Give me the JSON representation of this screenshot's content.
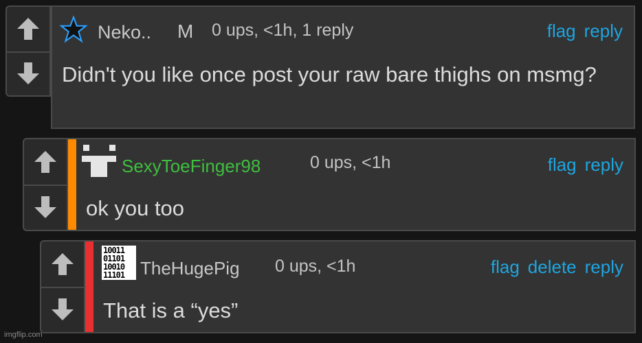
{
  "comments": [
    {
      "username": "Neko..",
      "badge": "M",
      "meta": "0 ups, <1h, 1 reply",
      "actions": [
        "flag",
        "reply"
      ],
      "text": "Didn't you like once post your raw bare thighs on msmg?",
      "avatar_icon": "star-outline-icon",
      "username_color": "#c8c8c8"
    },
    {
      "username": "SexyToeFinger98",
      "meta": "0 ups, <1h",
      "actions": [
        "flag",
        "reply"
      ],
      "text": "ok you too",
      "avatar_icon": "pixel-face-icon",
      "username_color": "#3fbf3f",
      "accent_color": "#ff8a00"
    },
    {
      "username": "TheHugePig",
      "meta": "0 ups, <1h",
      "actions": [
        "flag",
        "delete",
        "reply"
      ],
      "text": "That is a “yes”",
      "avatar_icon": "binary-code-icon",
      "avatar_text": [
        "10011",
        "01101",
        "10010",
        "11101"
      ],
      "username_color": "#c8c8c8",
      "accent_color": "#e83030"
    }
  ],
  "watermark": "imgflip.com",
  "colors": {
    "action": "#1ea5e0",
    "panel": "#333333",
    "background": "#151515"
  }
}
